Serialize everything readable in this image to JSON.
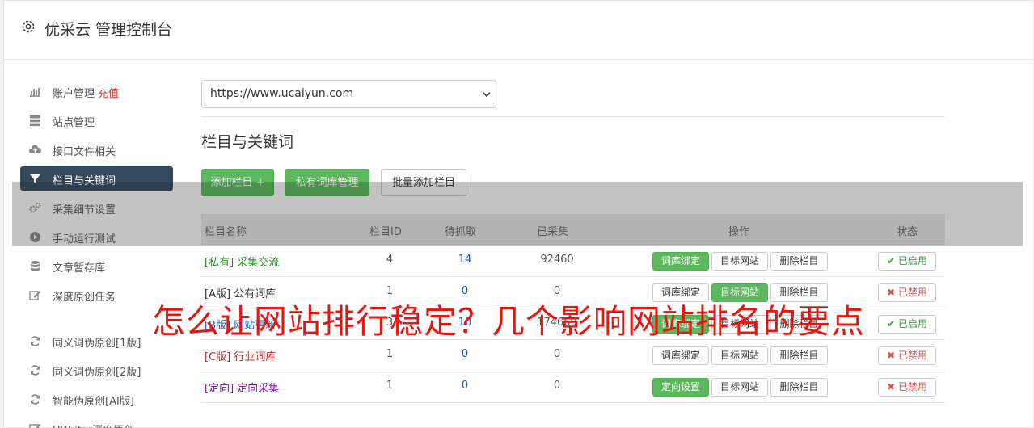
{
  "header": {
    "title": "优采云 管理控制台",
    "icon": "gear-icon"
  },
  "sidebar": {
    "items": [
      {
        "label": "账户管理",
        "extra": "充值",
        "icon": "bar-chart-icon"
      },
      {
        "label": "站点管理",
        "icon": "server-icon"
      },
      {
        "label": "接口文件相关",
        "icon": "cloud-upload-icon"
      },
      {
        "label": "栏目与关键词",
        "icon": "filter-icon",
        "active": true
      },
      {
        "label": "采集细节设置",
        "icon": "gears-icon"
      },
      {
        "label": "手动运行测试",
        "icon": "play-circle-icon"
      },
      {
        "label": "文章暂存库",
        "icon": "database-icon"
      },
      {
        "label": "深度原创任务",
        "icon": "edit-icon"
      },
      {
        "label": "同义词伪原创[1版]",
        "icon": "refresh-icon"
      },
      {
        "label": "同义词伪原创[2版]",
        "icon": "refresh-icon"
      },
      {
        "label": "智能伪原创[AI版]",
        "icon": "refresh-icon"
      },
      {
        "label": "UWriter深度原创",
        "icon": "edit-icon"
      }
    ]
  },
  "main": {
    "site_select": {
      "value": "https://www.ucaiyun.com"
    },
    "section_title": "栏目与关键词",
    "buttons": {
      "add_column": "添加栏目 +",
      "private_lib": "私有词库管理",
      "batch_add": "批量添加栏目"
    },
    "table": {
      "headers": {
        "name": "栏目名称",
        "id": "栏目ID",
        "pending": "待抓取",
        "collected": "已采集",
        "actions": "操作",
        "status": "状态"
      },
      "rows": [
        {
          "tag": "[私有]",
          "name": "采集交流",
          "id": "4",
          "pending": "14",
          "collected": "92460",
          "action1": "词库绑定",
          "action2": "目标网站",
          "action3": "删除栏目",
          "status": "已启用",
          "status_on": true,
          "tag_color": "#2e8b2e",
          "action1_green": true,
          "action2_green": false
        },
        {
          "tag": "[A版]",
          "name": "公有词库",
          "id": "1",
          "pending": "0",
          "collected": "0",
          "action1": "词库绑定",
          "action2": "目标网站",
          "action3": "删除栏目",
          "status": "已禁用",
          "status_on": false,
          "tag_color": "#333333",
          "action1_green": false,
          "action2_green": true
        },
        {
          "tag": "[B版]",
          "name": "网站更新",
          "id": "3",
          "pending": "10",
          "collected": "174669",
          "action1": "词库绑定",
          "action2": "目标网站",
          "action3": "删除栏目",
          "status": "已启用",
          "status_on": true,
          "tag_color": "#1a56c8",
          "action1_green": true,
          "action2_green": false
        },
        {
          "tag": "[C版]",
          "name": "行业词库",
          "id": "1",
          "pending": "0",
          "collected": "0",
          "action1": "词库绑定",
          "action2": "目标网站",
          "action3": "删除栏目",
          "status": "已禁用",
          "status_on": false,
          "tag_color": "#b03030",
          "action1_green": false,
          "action2_green": false
        },
        {
          "tag": "[定向]",
          "name": "定向采集",
          "id": "1",
          "pending": "0",
          "collected": "0",
          "action1": "定向设置",
          "action2": "目标网站",
          "action3": "删除栏目",
          "status": "已禁用",
          "status_on": false,
          "tag_color": "#7b1fa2",
          "action1_green": true,
          "action2_green": false
        }
      ]
    }
  },
  "overlay": {
    "headline": "怎么让网站排行稳定？几个影响网站排名的要点"
  },
  "colors": {
    "accent_green": "#5cb85c",
    "nav_active": "#34495e",
    "recharge_red": "#e4393c",
    "headline_red": "#e8140f"
  }
}
